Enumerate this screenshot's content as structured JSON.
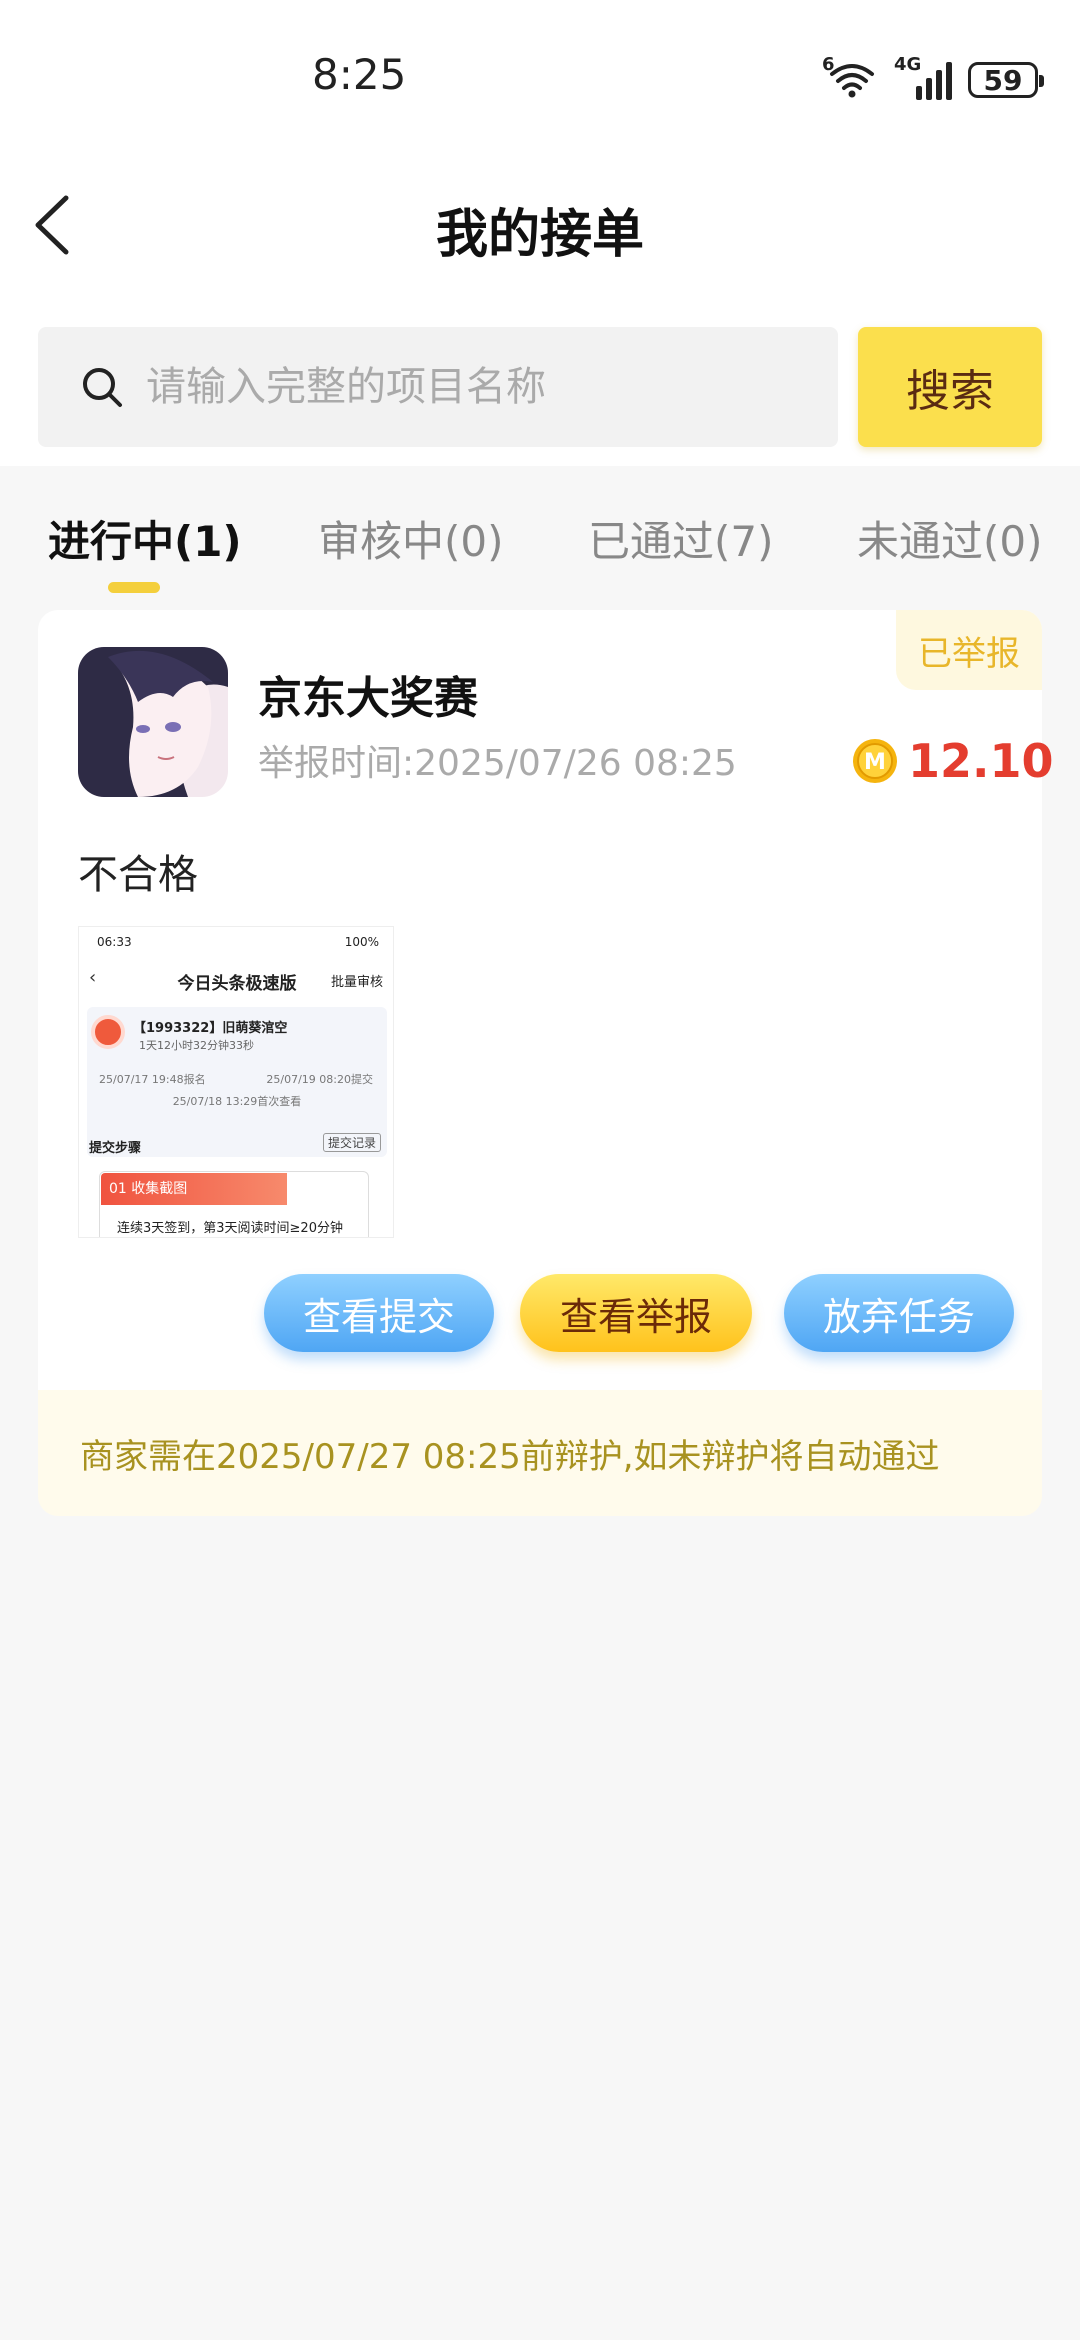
{
  "status_bar": {
    "time": "8:25",
    "wifi_tag": "6",
    "signal_tag": "4G",
    "battery": "59"
  },
  "header": {
    "title": "我的接单"
  },
  "search": {
    "placeholder": "请输入完整的项目名称",
    "value": "",
    "button_label": "搜索"
  },
  "tabs": [
    {
      "label": "进行中(1)",
      "active": true
    },
    {
      "label": "审核中(0)",
      "active": false
    },
    {
      "label": "已通过(7)",
      "active": false
    },
    {
      "label": "未通过(0)",
      "active": false
    }
  ],
  "card": {
    "badge": "已举报",
    "task_name": "京东大奖赛",
    "report_time": "举报时间:2025/07/26 08:25",
    "coin_letter": "M",
    "reward": "12.10",
    "result": "不合格",
    "screenshot": {
      "status_time": "06:33",
      "status_right": "100%",
      "title": "今日头条极速版",
      "batch": "批量审核",
      "user": "【1993322】旧萌葵涫空",
      "duration": "1天12小时32分钟33秒",
      "date_signup": "25/07/17 19:48报名",
      "date_submit": "25/07/19 08:20提交",
      "date_first_view": "25/07/18 13:29首次查看",
      "steps_label": "提交步骤",
      "record_label": "提交记录",
      "step_title": "01 收集截图",
      "step_desc": "连续3天签到，第3天阅读时间≥20分钟"
    },
    "actions": {
      "view_submit": "查看提交",
      "view_report": "查看举报",
      "abandon": "放弃任务"
    },
    "notice": "商家需在2025/07/27 08:25前辩护,如未辩护将自动通过"
  },
  "colors": {
    "accent_yellow": "#fbdf4d",
    "reward_red": "#e43d2f",
    "badge_text": "#e8b62a",
    "notice_text": "#a89220",
    "button_blue": "#4fa6f4"
  }
}
